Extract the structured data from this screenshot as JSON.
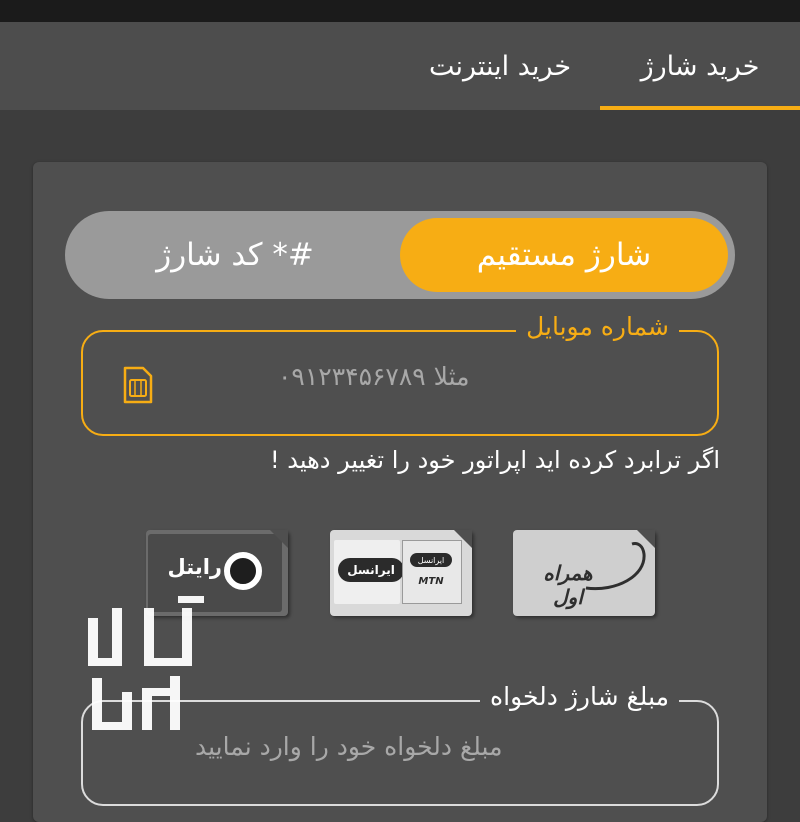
{
  "tabs": [
    {
      "label": "خرید شارژ",
      "active": true
    },
    {
      "label": "خرید اینترنت",
      "active": false
    }
  ],
  "charge_type": {
    "active_option": "شارژ مستقیم",
    "inactive_option": "#* کد شارژ"
  },
  "mobile_field": {
    "label": "شماره موبایل",
    "placeholder": "مثلا ۰۹۱۲۳۴۵۶۷۸۹",
    "icon": "sim-card-icon"
  },
  "operator_note": "اگر ترابرد کرده اید اپراتور خود را تغییر دهید !",
  "operators": [
    {
      "name": "رایتل",
      "icon": "rightel-logo"
    },
    {
      "name": "ایرانسل",
      "sub_name": "ایرانسل",
      "badge": "MTN",
      "icon": "irancell-logo"
    },
    {
      "name": "همراه اول",
      "icon": "hamrah-aval-logo"
    }
  ],
  "amount_field": {
    "label": "مبلغ شارژ دلخواه",
    "placeholder": "مبلغ دلخواه خود را وارد نمایید"
  },
  "watermark_text": "آسان مال",
  "colors": {
    "accent": "#f7ad14",
    "background": "#3d3d3d",
    "card": "#4f4f4f",
    "tabbar": "#4d4d4d"
  }
}
